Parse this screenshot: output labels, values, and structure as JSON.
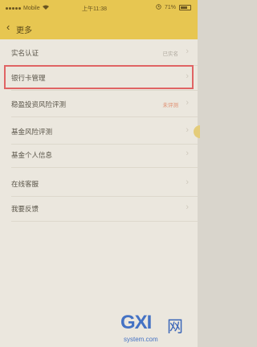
{
  "status_bar": {
    "carrier": "Mobile",
    "time": "上午11:38",
    "battery": "71%",
    "battery_level": 0.71
  },
  "nav": {
    "back_icon": "chevron-left",
    "title": "更多"
  },
  "menu": [
    {
      "label": "实名认证",
      "value": "已实名",
      "chevron": true
    },
    {
      "label": "银行卡管理",
      "value": "",
      "chevron": true
    },
    {
      "label": "稳盈投资风险评测",
      "value": "未评测",
      "chevron": true,
      "value_color": "#e08d6e"
    },
    {
      "label": "基金风险评测",
      "value": "",
      "chevron": true
    },
    {
      "label": "基金个人信息",
      "value": "",
      "chevron": true
    },
    {
      "label": "在线客服",
      "value": "",
      "chevron": true
    },
    {
      "label": "我要反馈",
      "value": "",
      "chevron": true
    }
  ],
  "accent_color": "#e7c651",
  "highlight_color": "#e06464",
  "watermark": {
    "logo": "GXI",
    "cn": "网",
    "url": "system.com"
  }
}
